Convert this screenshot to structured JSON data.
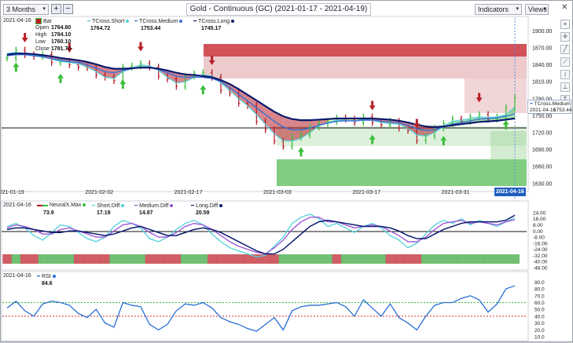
{
  "toolbar": {
    "period": "3 Months",
    "plus": "+",
    "minus": "−",
    "title": "Gold - Continuous (GC) (2021-01-17 - 2021-04-19)",
    "indicators": "Indicators",
    "views": "Views",
    "close": "✕"
  },
  "price_legend": {
    "date": "2021-04-16",
    "bar": "Bar",
    "open_l": "Open",
    "open_v": "1764.80",
    "high_l": "High",
    "high_v": "1784.10",
    "low_l": "Low",
    "low_v": "1760.10",
    "close_l": "Close",
    "close_v": "1781.70",
    "short_l": "TCross.Short",
    "short_v": "1764.72",
    "medium_l": "TCross.Medium",
    "medium_v": "1753.44",
    "long_l": "TCross.Long",
    "long_v": "1745.17"
  },
  "price_flag": {
    "name": "TCross.Medium",
    "date": "2021-04-16",
    "value": "1753.44"
  },
  "diff_legend": {
    "date": "2021-04-16",
    "nmax_l": "NeuralX.Max",
    "nmax_v": "73.9",
    "short_l": "Short.Diff",
    "short_v": "17.19",
    "medium_l": "Medium.Diff",
    "medium_v": "14.87",
    "long_l": "Long.Diff",
    "long_v": "20.59"
  },
  "rsi_legend": {
    "date": "2021-04-16",
    "name": "RSI",
    "value": "84.6"
  },
  "x_axis": {
    "labels": [
      "2021-01-19",
      "2021-02-02",
      "2021-02-17",
      "2021-03-03",
      "2021-03-17",
      "2021-03-31"
    ],
    "current": "2021-04-16"
  },
  "colors": {
    "short": "#4fd1d9",
    "medium": "#3a6fd6",
    "long": "#0a1a6e",
    "up": "#3cbf3c",
    "down": "#b8202a",
    "neutral_fill": "#f3ee6a",
    "diff_medium": "#9b4fd6",
    "rsi": "#2a6fd6",
    "rsi_upper": "#2db82d",
    "rsi_lower": "#d62d2d"
  },
  "chart_data": [
    {
      "type": "line",
      "title": "Gold - Continuous (GC) (2021-01-17 - 2021-04-19)",
      "ylim": [
        1620,
        1920
      ],
      "yticks": [
        1900.0,
        1870.0,
        1840.0,
        1810.0,
        1780.0,
        1750.0,
        1720.0,
        1690.0,
        1660.0,
        1630.0
      ],
      "series": [
        {
          "name": "TCross.Short",
          "values": [
            1860,
            1862,
            1860,
            1857,
            1855,
            1850,
            1846,
            1844,
            1842,
            1836,
            1828,
            1818,
            1816,
            1828,
            1834,
            1840,
            1838,
            1830,
            1818,
            1808,
            1810,
            1818,
            1822,
            1820,
            1808,
            1795,
            1780,
            1768,
            1752,
            1735,
            1718,
            1706,
            1705,
            1710,
            1720,
            1732,
            1738,
            1742,
            1742,
            1740,
            1744,
            1742,
            1738,
            1736,
            1735,
            1728,
            1716,
            1714,
            1720,
            1732,
            1740,
            1742,
            1745,
            1748,
            1747,
            1748,
            1752,
            1764.72
          ]
        },
        {
          "name": "TCross.Medium",
          "values": [
            1856,
            1858,
            1858,
            1856,
            1854,
            1851,
            1848,
            1846,
            1844,
            1840,
            1834,
            1828,
            1826,
            1830,
            1833,
            1836,
            1836,
            1832,
            1826,
            1820,
            1818,
            1818,
            1818,
            1816,
            1810,
            1800,
            1788,
            1776,
            1764,
            1752,
            1740,
            1730,
            1725,
            1725,
            1728,
            1733,
            1737,
            1740,
            1741,
            1741,
            1742,
            1742,
            1740,
            1739,
            1737,
            1733,
            1727,
            1724,
            1725,
            1730,
            1735,
            1738,
            1741,
            1744,
            1745,
            1746,
            1749,
            1753.44
          ]
        },
        {
          "name": "TCross.Long",
          "values": [
            1858,
            1860,
            1860,
            1859,
            1857,
            1855,
            1852,
            1850,
            1848,
            1845,
            1841,
            1836,
            1833,
            1833,
            1834,
            1835,
            1835,
            1833,
            1830,
            1826,
            1823,
            1822,
            1820,
            1818,
            1813,
            1806,
            1797,
            1787,
            1777,
            1767,
            1757,
            1749,
            1744,
            1742,
            1742,
            1743,
            1744,
            1745,
            1745,
            1745,
            1745,
            1745,
            1744,
            1743,
            1741,
            1738,
            1734,
            1731,
            1730,
            1731,
            1733,
            1735,
            1737,
            1739,
            1740,
            1741,
            1743,
            1745.17
          ]
        }
      ],
      "ohlc_close": [
        1852,
        1866,
        1858,
        1855,
        1858,
        1844,
        1846,
        1840,
        1836,
        1835,
        1822,
        1818,
        1812,
        1836,
        1838,
        1842,
        1836,
        1820,
        1815,
        1802,
        1820,
        1824,
        1826,
        1818,
        1795,
        1790,
        1772,
        1768,
        1740,
        1725,
        1705,
        1696,
        1712,
        1716,
        1730,
        1736,
        1740,
        1746,
        1744,
        1738,
        1748,
        1738,
        1734,
        1740,
        1728,
        1724,
        1706,
        1714,
        1728,
        1736,
        1744,
        1740,
        1748,
        1752,
        1744,
        1748,
        1764,
        1781.7
      ],
      "last_bar": {
        "open": 1764.8,
        "high": 1784.1,
        "low": 1760.1,
        "close": 1781.7
      }
    },
    {
      "type": "line",
      "ylim": [
        -48,
        26
      ],
      "yticks": [
        24.0,
        16.0,
        8.0,
        0.0,
        -8.0,
        -16.0,
        -24.0,
        -32.0,
        -40.0,
        -48.0
      ],
      "series": [
        {
          "name": "Short.Diff",
          "values": [
            6,
            10,
            4,
            -6,
            -12,
            -2,
            8,
            6,
            -2,
            -10,
            -14,
            -8,
            6,
            14,
            10,
            4,
            -10,
            -14,
            -8,
            2,
            10,
            14,
            8,
            -4,
            -14,
            -22,
            -26,
            -30,
            -34,
            -32,
            -20,
            -8,
            10,
            18,
            22,
            16,
            6,
            10,
            4,
            -2,
            6,
            10,
            4,
            -6,
            -12,
            -22,
            -16,
            -4,
            8,
            14,
            10,
            16,
            8,
            14,
            10,
            6,
            12,
            17.19
          ]
        },
        {
          "name": "Medium.Diff",
          "values": [
            4,
            8,
            6,
            2,
            -4,
            -4,
            2,
            4,
            0,
            -4,
            -8,
            -8,
            0,
            8,
            10,
            6,
            -2,
            -8,
            -8,
            -2,
            6,
            10,
            8,
            2,
            -6,
            -14,
            -20,
            -24,
            -28,
            -30,
            -22,
            -12,
            2,
            12,
            18,
            18,
            12,
            12,
            8,
            4,
            6,
            8,
            6,
            0,
            -6,
            -14,
            -14,
            -8,
            2,
            10,
            12,
            14,
            10,
            12,
            10,
            8,
            12,
            14.87
          ]
        },
        {
          "name": "Long.Diff",
          "values": [
            2,
            4,
            4,
            2,
            0,
            -2,
            -2,
            0,
            0,
            -2,
            -4,
            -6,
            -4,
            0,
            4,
            6,
            2,
            -2,
            -6,
            -6,
            -2,
            2,
            4,
            2,
            -2,
            -8,
            -14,
            -20,
            -26,
            -30,
            -30,
            -24,
            -14,
            -4,
            6,
            12,
            14,
            12,
            10,
            8,
            6,
            6,
            6,
            4,
            0,
            -6,
            -10,
            -10,
            -4,
            2,
            6,
            10,
            12,
            12,
            12,
            12,
            14,
            20.59
          ]
        }
      ],
      "neuralx_signal": [
        "down",
        "up",
        "down",
        "down",
        "up",
        "up",
        "up",
        "up",
        "down",
        "down",
        "down",
        "down",
        "up",
        "up",
        "up",
        "up",
        "down",
        "down",
        "down",
        "down",
        "up",
        "up",
        "up",
        "down",
        "down",
        "down",
        "down",
        "down",
        "down",
        "down",
        "down",
        "up",
        "up",
        "up",
        "up",
        "up",
        "up",
        "down",
        "up",
        "up",
        "up",
        "up",
        "up",
        "down",
        "down",
        "down",
        "down",
        "up",
        "up",
        "up",
        "up",
        "up",
        "up",
        "up",
        "up",
        "up",
        "up",
        "up"
      ]
    },
    {
      "type": "line",
      "ylim": [
        10,
        95
      ],
      "yticks": [
        90.0,
        80.0,
        70.0,
        60.0,
        50.0,
        40.0,
        30.0,
        20.0,
        10.0
      ],
      "series": [
        {
          "name": "RSI",
          "values": [
            52,
            62,
            48,
            40,
            58,
            62,
            60,
            56,
            44,
            38,
            50,
            30,
            24,
            60,
            56,
            54,
            28,
            20,
            28,
            48,
            58,
            56,
            60,
            52,
            38,
            32,
            28,
            22,
            18,
            28,
            38,
            20,
            48,
            54,
            56,
            56,
            58,
            60,
            54,
            40,
            64,
            52,
            40,
            58,
            38,
            30,
            20,
            40,
            56,
            60,
            60,
            66,
            70,
            64,
            46,
            58,
            80,
            84.6
          ]
        }
      ],
      "levels": [
        {
          "value": 60,
          "color": "#2db82d"
        },
        {
          "value": 40,
          "color": "#d62d2d"
        }
      ]
    }
  ]
}
